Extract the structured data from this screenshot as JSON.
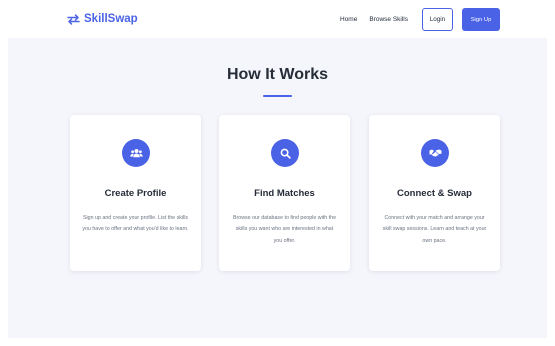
{
  "brand": {
    "name": "SkillSwap",
    "icon": "swap-arrows-icon",
    "color": "#4a62e6"
  },
  "nav": {
    "home": "Home",
    "browse": "Browse Skills",
    "login": "Login",
    "signup": "Sign Up"
  },
  "section": {
    "title": "How It Works",
    "cards": [
      {
        "icon": "users-icon",
        "title": "Create Profile",
        "description": "Sign up and create your profile. List the skills you have to offer and what you'd like to learn."
      },
      {
        "icon": "search-icon",
        "title": "Find Matches",
        "description": "Browse our database to find people with the skills you want who are interested in what you offer."
      },
      {
        "icon": "handshake-icon",
        "title": "Connect & Swap",
        "description": "Connect with your match and arrange your skill swap sessions. Learn and teach at your own pace."
      }
    ]
  },
  "colors": {
    "accent": "#4a62e6",
    "background": "#f5f6fb",
    "card": "#ffffff"
  }
}
